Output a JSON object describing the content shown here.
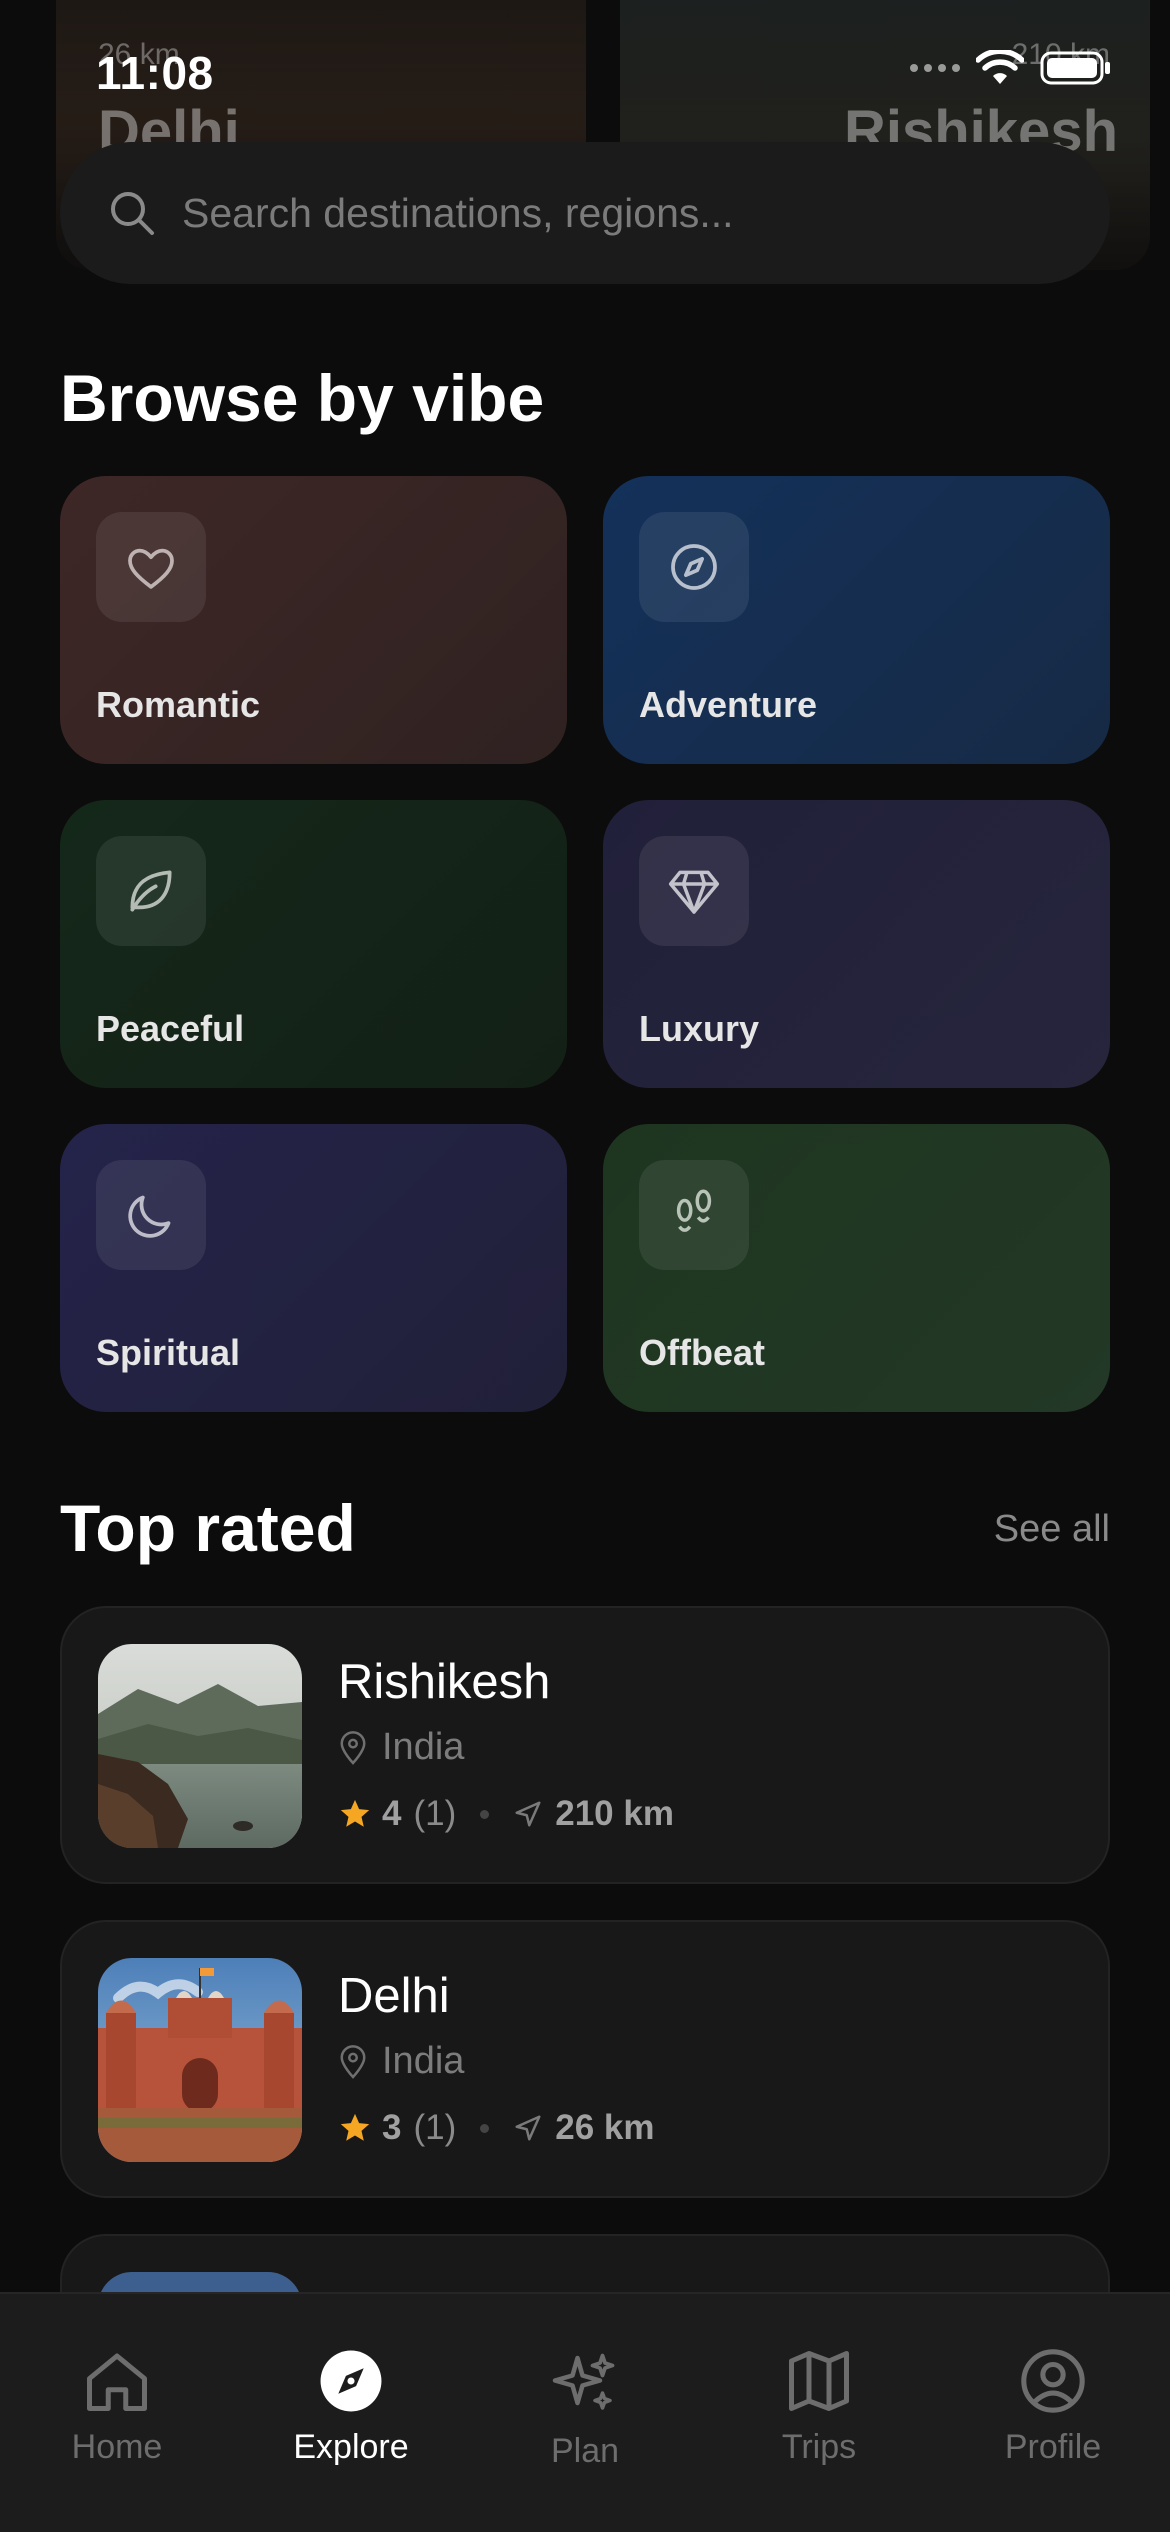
{
  "status_bar": {
    "time": "11:08"
  },
  "hero_peek": {
    "left": {
      "distance": "26 km",
      "name": "Delhi"
    },
    "right": {
      "distance": "210 km",
      "name": "Rishikesh"
    }
  },
  "search": {
    "placeholder": "Search destinations, regions...",
    "value": ""
  },
  "browse": {
    "title": "Browse by vibe",
    "vibes": [
      {
        "label": "Romantic",
        "icon": "heart-icon",
        "color": "#3a2625"
      },
      {
        "label": "Adventure",
        "icon": "compass-icon",
        "color": "#163150"
      },
      {
        "label": "Peaceful",
        "icon": "leaf-icon",
        "color": "#16281a"
      },
      {
        "label": "Luxury",
        "icon": "diamond-icon",
        "color": "#24223a"
      },
      {
        "label": "Spiritual",
        "icon": "moon-icon",
        "color": "#222240"
      },
      {
        "label": "Offbeat",
        "icon": "footprints-icon",
        "color": "#1f3422"
      }
    ]
  },
  "top_rated": {
    "title": "Top rated",
    "see_all": "See all",
    "places": [
      {
        "name": "Rishikesh",
        "country": "India",
        "rating": "4",
        "count": "(1)",
        "distance": "210 km"
      },
      {
        "name": "Delhi",
        "country": "India",
        "rating": "3",
        "count": "(1)",
        "distance": "26 km"
      }
    ]
  },
  "tab_bar": {
    "tabs": [
      {
        "label": "Home",
        "icon": "home-icon",
        "active": false
      },
      {
        "label": "Explore",
        "icon": "compass-icon",
        "active": true
      },
      {
        "label": "Plan",
        "icon": "sparkles-icon",
        "active": false
      },
      {
        "label": "Trips",
        "icon": "map-icon",
        "active": false
      },
      {
        "label": "Profile",
        "icon": "user-circle-icon",
        "active": false
      }
    ]
  },
  "colors": {
    "background": "#0c0c0c",
    "card": "#181818",
    "star": "#f5a623",
    "muted_text": "#7c7c7c"
  }
}
